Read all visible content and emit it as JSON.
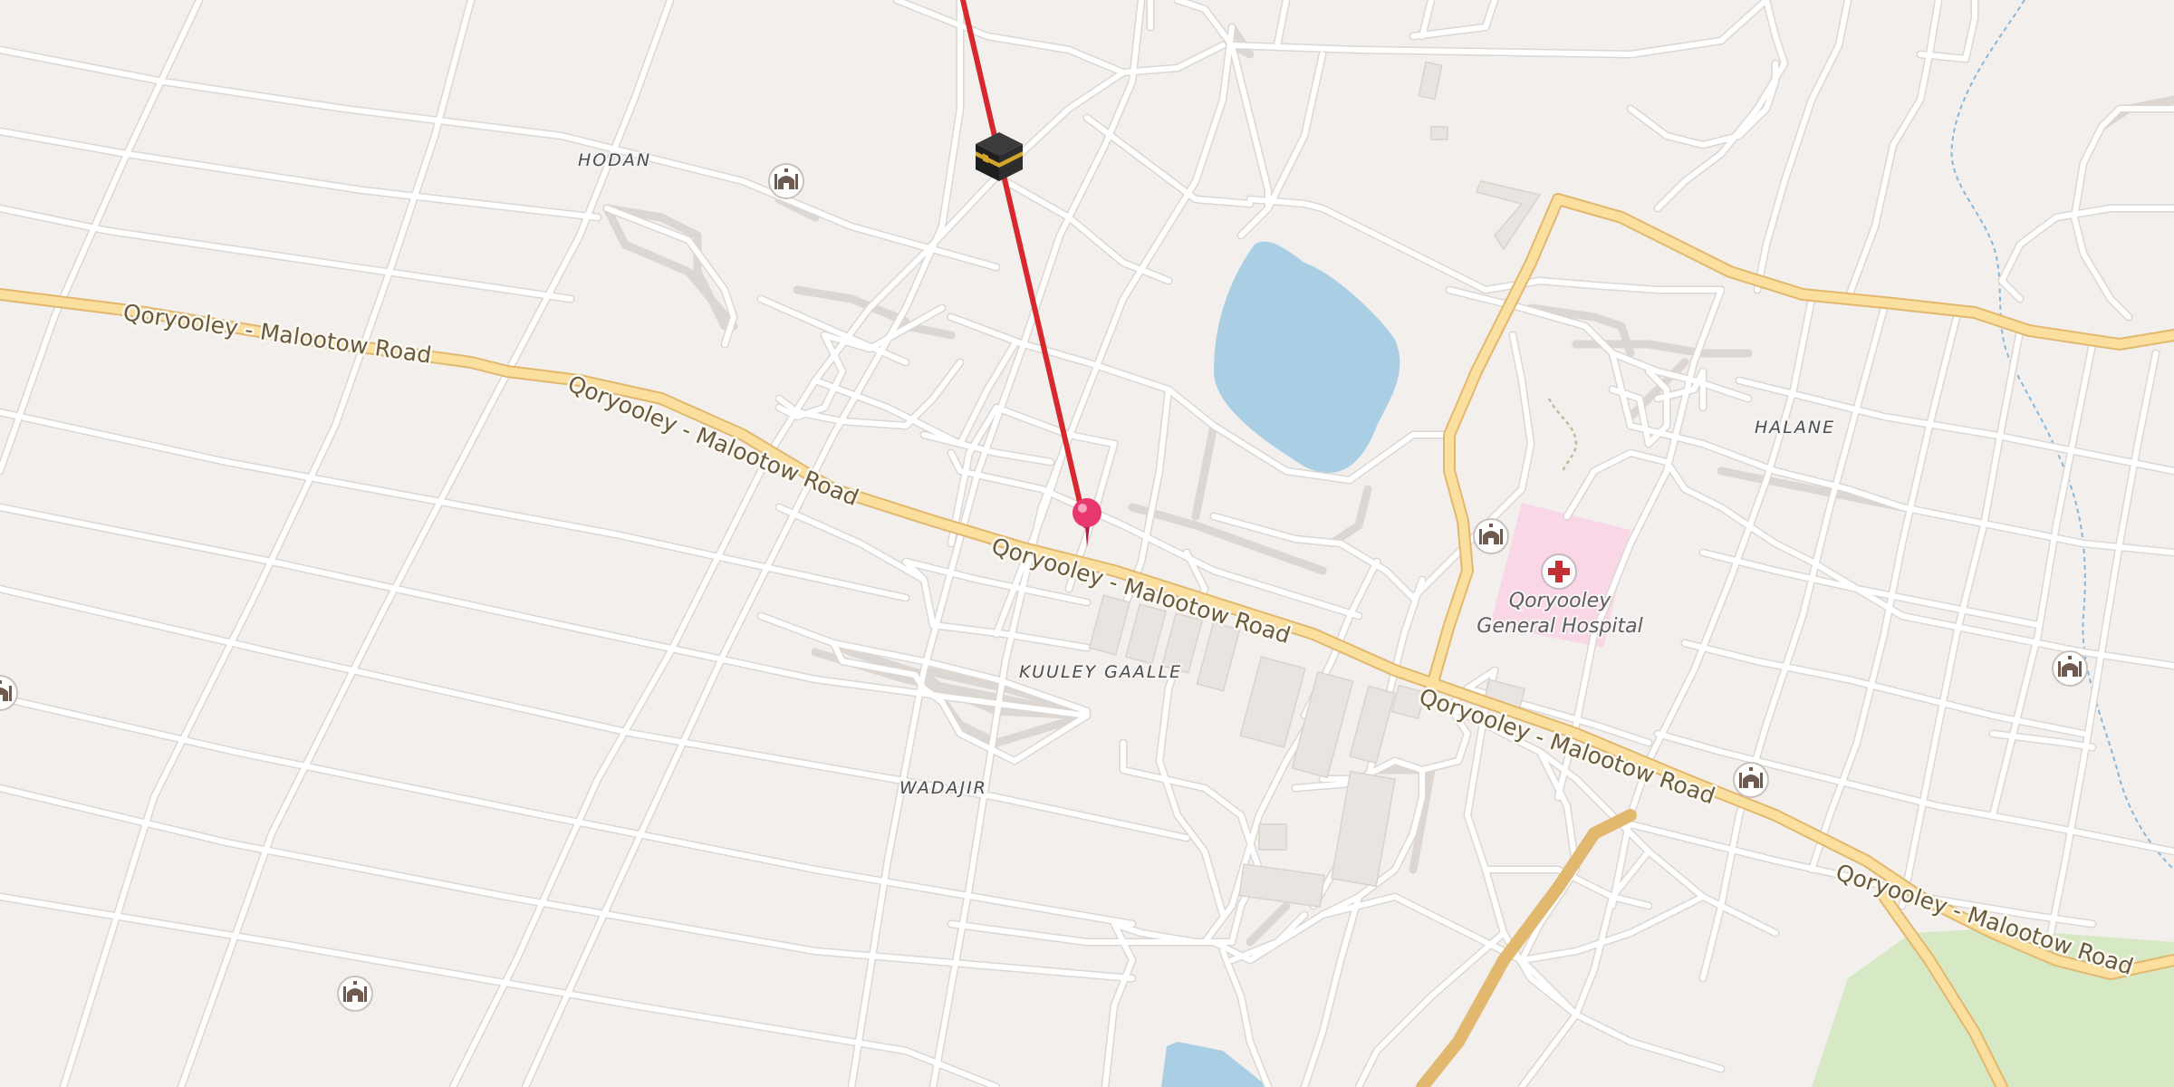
{
  "map": {
    "road_labels": {
      "west": "Qoryooley - Malootow Road",
      "center_west": "Qoryooley - Malootow Road",
      "center": "Qoryooley - Malootow Road",
      "east": "Qoryooley - Malootow Road",
      "far_east": "Qoryooley - Malootow Road"
    },
    "districts": {
      "hodan": "HODAN",
      "halane": "HALANE",
      "kuuley_gaalle": "KUULEY GAALLE",
      "wadajir": "WADAJIR"
    },
    "hospital": {
      "name_line1": "Qoryooley",
      "name_line2": "General Hospital",
      "icon": "hospital-cross-icon"
    },
    "mosque_icon": "mosque-icon",
    "kaaba_icon": "kaaba-icon",
    "location_pin_icon": "map-pin-icon",
    "qibla_line_color": "#d7282f",
    "pin_color": "#e8396f",
    "water_color": "#aacfe4",
    "park_color": "#d6e9c4",
    "major_road_color": "#fbdf9e",
    "hospital_area_color": "#fad7e6"
  }
}
